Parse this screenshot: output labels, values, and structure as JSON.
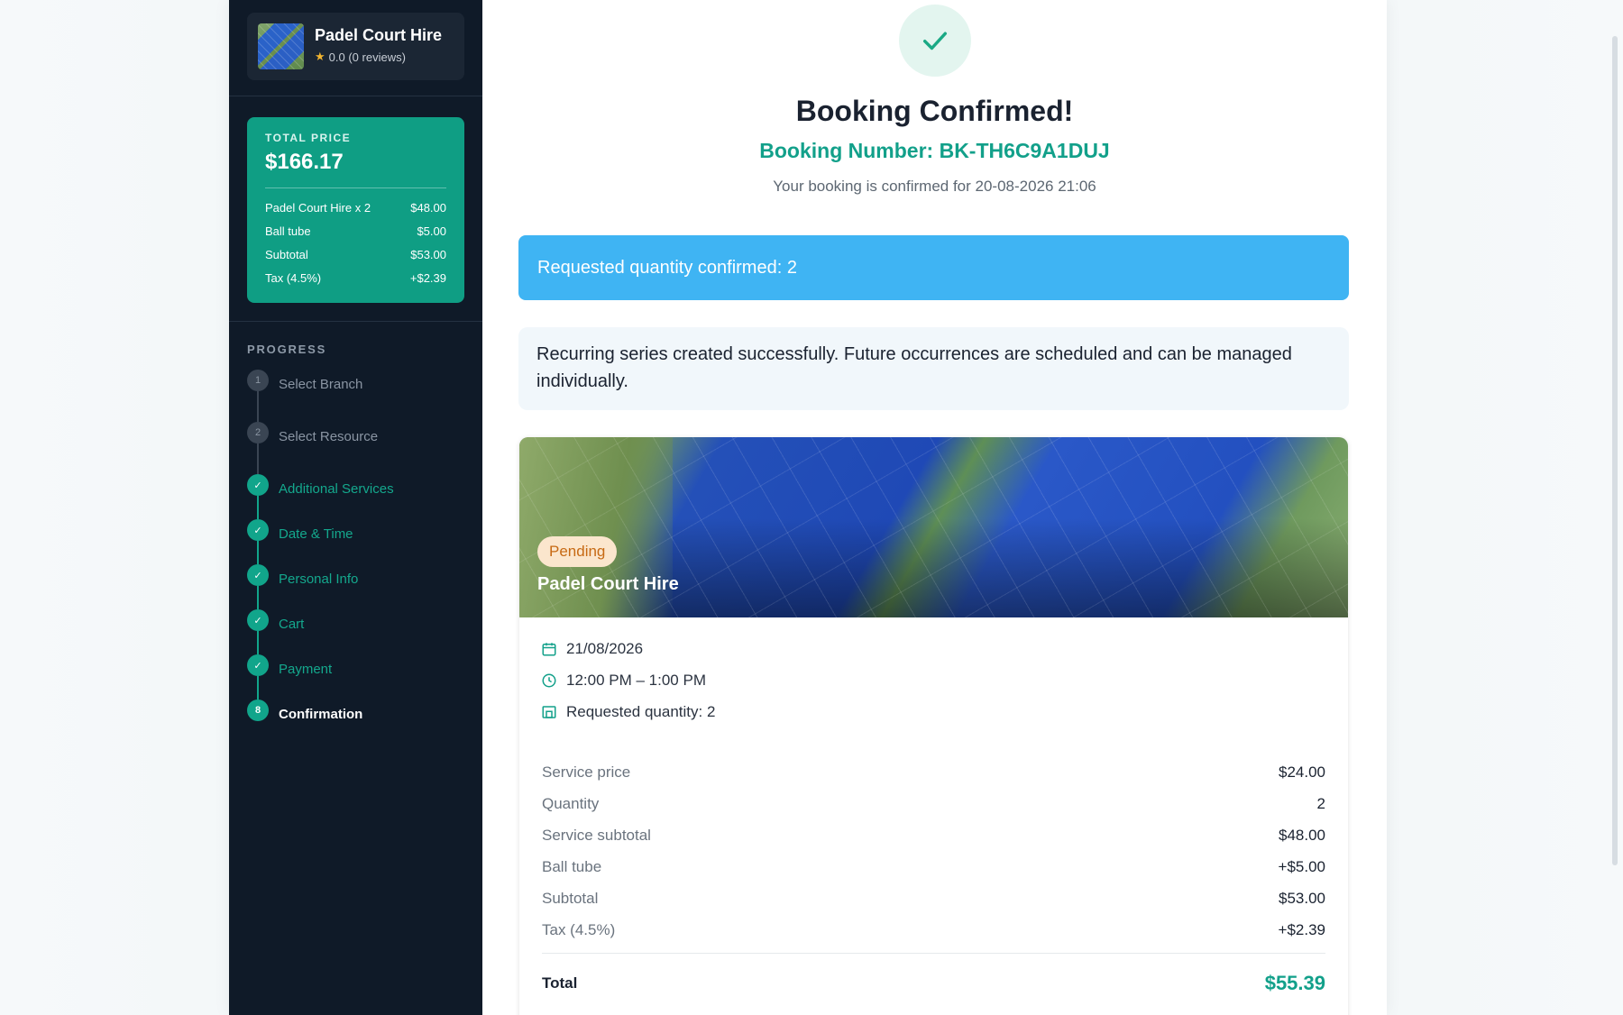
{
  "sidebar": {
    "brand": {
      "name": "Padel Court Hire",
      "rating": "0.0 (0 reviews)"
    },
    "price": {
      "caption": "TOTAL PRICE",
      "total": "$166.17",
      "rows": [
        {
          "label": "Padel Court Hire x 2",
          "amount": "$48.00"
        },
        {
          "label": "Ball tube",
          "amount": "$5.00"
        },
        {
          "label": "Subtotal",
          "amount": "$53.00"
        },
        {
          "label": "Tax (4.5%)",
          "amount": "+$2.39"
        }
      ]
    },
    "progress_caption": "PROGRESS",
    "steps": [
      {
        "marker": "1",
        "label": "Select Branch",
        "state": "pending"
      },
      {
        "marker": "2",
        "label": "Select Resource",
        "state": "pending"
      },
      {
        "marker": "✓",
        "label": "Additional Services",
        "state": "done"
      },
      {
        "marker": "✓",
        "label": "Date & Time",
        "state": "done"
      },
      {
        "marker": "✓",
        "label": "Personal Info",
        "state": "done"
      },
      {
        "marker": "✓",
        "label": "Cart",
        "state": "done"
      },
      {
        "marker": "✓",
        "label": "Payment",
        "state": "done"
      },
      {
        "marker": "8",
        "label": "Confirmation",
        "state": "current"
      }
    ]
  },
  "main": {
    "title": "Booking Confirmed!",
    "booking_number": "Booking Number: BK-TH6C9A1DUJ",
    "subtitle": "Your booking is confirmed for 20-08-2026 21:06",
    "alert_info": "Requested quantity confirmed: 2",
    "alert_note": "Recurring series created successfully. Future occurrences are scheduled and can be managed individually.",
    "card": {
      "status": "Pending",
      "title": "Padel Court Hire",
      "date": "21/08/2026",
      "time": "12:00 PM – 1:00 PM",
      "quantity_text": "Requested quantity: 2",
      "lines": [
        {
          "label": "Service price",
          "value": "$24.00"
        },
        {
          "label": "Quantity",
          "value": "2"
        },
        {
          "label": "Service subtotal",
          "value": "$48.00"
        },
        {
          "label": "Ball tube",
          "value": "+$5.00"
        },
        {
          "label": "Subtotal",
          "value": "$53.00"
        },
        {
          "label": "Tax (4.5%)",
          "value": "+$2.39"
        }
      ],
      "total_label": "Total",
      "total_value": "$55.39"
    }
  },
  "colors": {
    "accent": "#12a08a",
    "sidebar": "#0f1a28",
    "info": "#3fb4f3",
    "pending_badge": "#fbe6cd"
  },
  "icons": [
    "star-icon",
    "check-icon",
    "calendar-icon",
    "clock-icon",
    "quantity-icon"
  ]
}
